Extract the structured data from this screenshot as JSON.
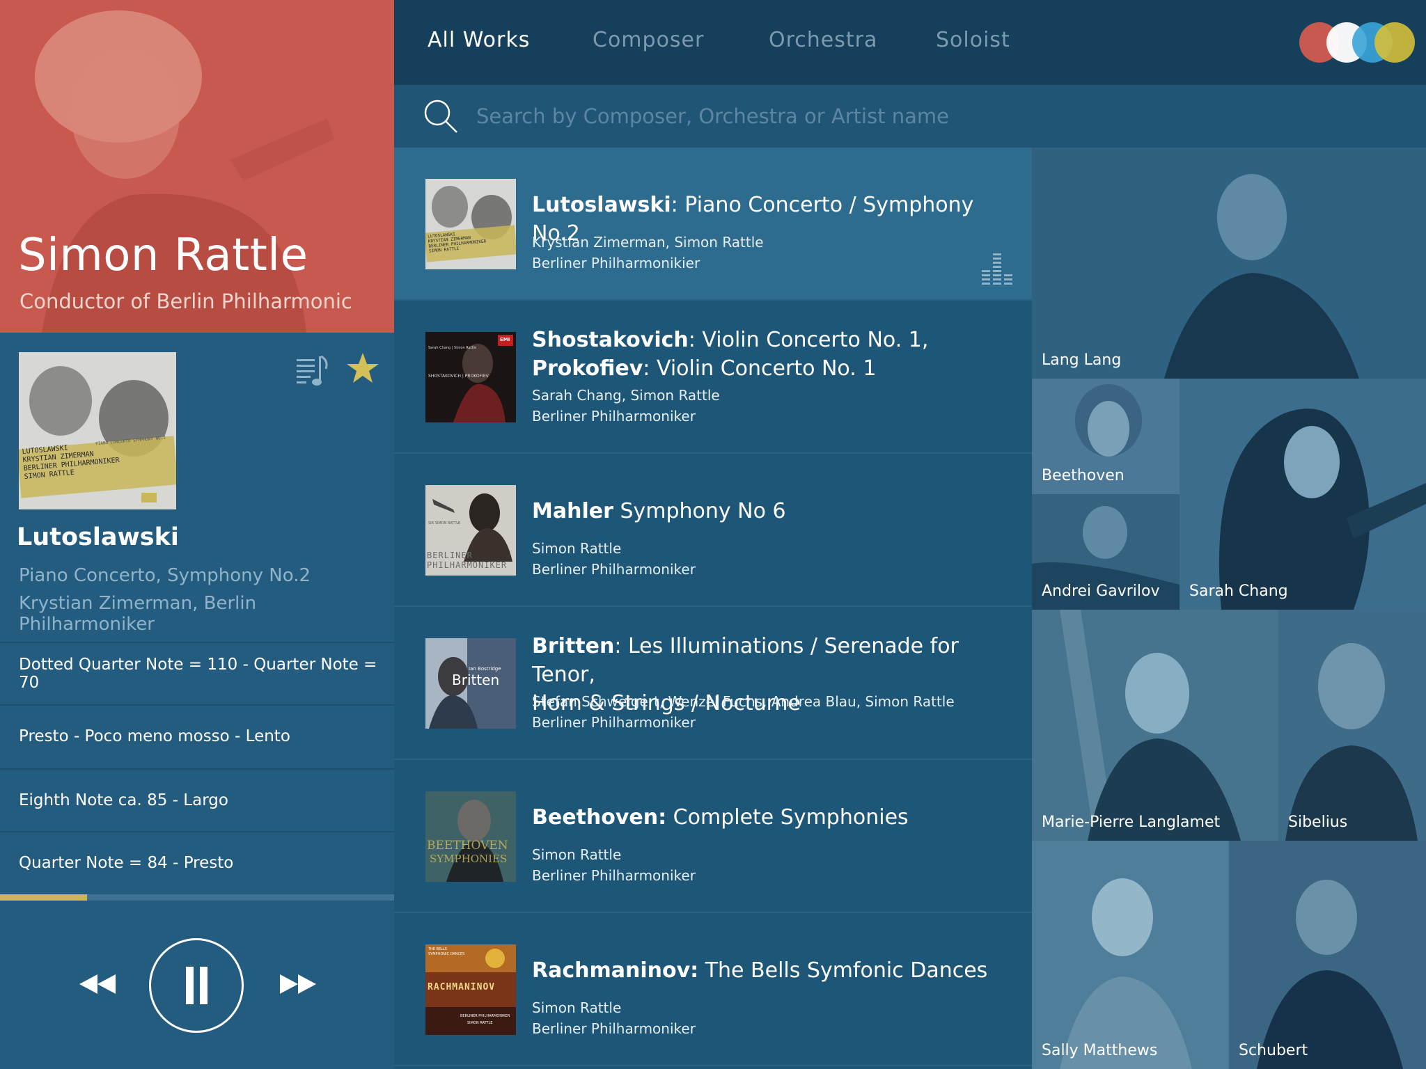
{
  "app": {
    "tabs": [
      {
        "label": "All Works"
      },
      {
        "label": "Composer"
      },
      {
        "label": "Orchestra"
      },
      {
        "label": "Soloist"
      }
    ],
    "search_placeholder": "Search by Composer, Orchestra or Artist name"
  },
  "artist": {
    "name": "Simon Rattle",
    "role": "Conductor of Berlin Philharmonic"
  },
  "now_playing": {
    "title": "Lutoslawski",
    "subtitle": "Piano Concerto, Symphony No.2",
    "performers": "Krystian Zimerman, Berlin Philharmoniker",
    "album_cover_lines": [
      "LUTOSLAWSKI",
      "KRYSTIAN ZIMERMAN",
      "BERLINER PHILHARMONIKER",
      "SIMON RATTLE"
    ],
    "album_cover_small": "PIANO CONCERTO SYMPHONY NO.2",
    "progress": 0.22,
    "movements": [
      {
        "label": "Dotted Quarter Note = 110 - Quarter Note = 70"
      },
      {
        "label": "Presto - Poco meno mosso - Lento"
      },
      {
        "label": "Eighth Note ca. 85 - Largo"
      },
      {
        "label": "Quarter Note = 84 - Presto"
      }
    ]
  },
  "works": [
    {
      "composer": "Lutoslawski",
      "sep": ": ",
      "title": "Piano Concerto / Symphony No.2",
      "composer2": "",
      "sep2": "",
      "title2": "",
      "performers": "Krystian Zimerman, Simon Rattle",
      "orchestra": "Berliner Philharmonikier",
      "selected": true,
      "cover_lines": [
        "LUTOSLAWSKI",
        "KRYSTIAN ZIMERMAN",
        "BERLINER PHILHARMONIKER",
        "SIMON RATTLE"
      ]
    },
    {
      "composer": "Shostakovich",
      "sep": ": ",
      "title": "Violin Concerto No. 1,",
      "composer2": "Prokofiev",
      "sep2": ": ",
      "title2": "Violin Concerto No. 1",
      "performers": "Sarah Chang, Simon Rattle",
      "orchestra": "Berliner Philharmoniker",
      "selected": false,
      "cover_lines": [
        "Sarah Chang | Simon Rattle",
        "SHOSTAKOVICH | PROKOFIEV",
        "EMI"
      ]
    },
    {
      "composer": "Mahler",
      "sep": " ",
      "title": "Symphony No 6",
      "composer2": "",
      "sep2": "",
      "title2": "",
      "performers": "Simon Rattle",
      "orchestra": "Berliner Philharmoniker",
      "selected": false,
      "cover_lines": [
        "SIR SIMON RATTLE",
        "BERLINER",
        "PHILHARMONIKER"
      ]
    },
    {
      "composer": "Britten",
      "sep": ": ",
      "title": "Les Illuminations / Serenade for Tenor,",
      "composer2": "",
      "sep2": "",
      "title2": "Horn & Strings / Nocturne",
      "performers": "Stefan Schweigert, Wenzel Fuchs, Andrea Blau, Simon Rattle",
      "orchestra": "Berliner Philharmoniker",
      "selected": false,
      "cover_lines": [
        "Ian Bostridge",
        "Britten"
      ]
    },
    {
      "composer": "Beethoven:",
      "sep": " ",
      "title": "Complete Symphonies",
      "composer2": "",
      "sep2": "",
      "title2": "",
      "performers": "Simon Rattle",
      "orchestra": "Berliner Philharmoniker",
      "selected": false,
      "cover_lines": [
        "BEETHOVEN",
        "SYMPHONIES"
      ]
    },
    {
      "composer": "Rachmaninov:",
      "sep": " ",
      "title": "The Bells Symfonic Dances",
      "composer2": "",
      "sep2": "",
      "title2": "",
      "performers": "Simon Rattle",
      "orchestra": "Berliner Philharmoniker",
      "selected": false,
      "cover_lines": [
        "THE BELLS",
        "SYMPHONIC DANCES",
        "RACHMANINOV",
        "BERLINER PHILHARMONIKER",
        "SIMON RATTLE"
      ]
    }
  ],
  "artists_grid": [
    {
      "name": "Lang Lang"
    },
    {
      "name": "Beethoven"
    },
    {
      "name": "Andrei Gavrilov"
    },
    {
      "name": "Sarah Chang"
    },
    {
      "name": "Marie-Pierre Langlamet"
    },
    {
      "name": "Sibelius"
    },
    {
      "name": "Sally Matthews"
    },
    {
      "name": "Schubert"
    }
  ],
  "colors": {
    "accent_red": "#c8594f",
    "accent_yellow": "#c9b75a",
    "panel_blue": "#245c80",
    "topbar": "#163f5b"
  }
}
